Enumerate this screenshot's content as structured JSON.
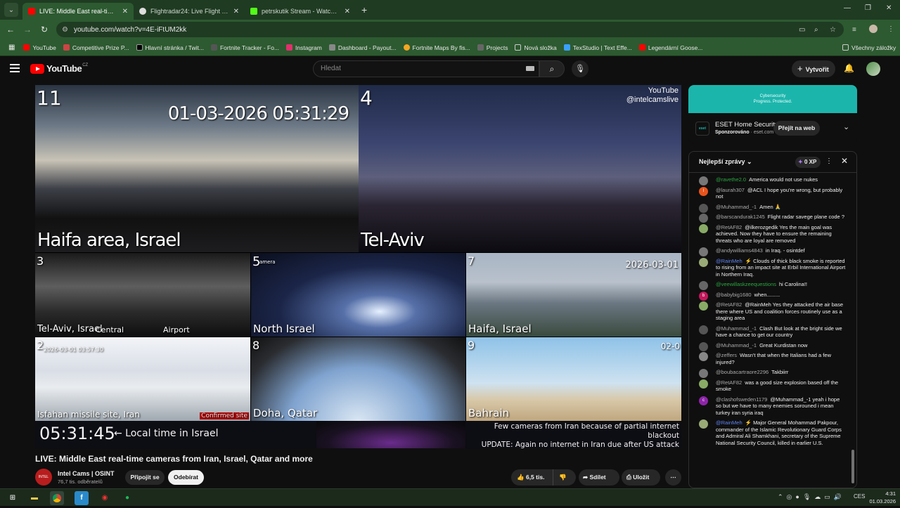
{
  "browser": {
    "tabs": [
      {
        "title": "LIVE: Middle East real-time cam",
        "active": true,
        "favicon_color": "#ff0000"
      },
      {
        "title": "Flightradar24: Live Flight Track",
        "active": false,
        "favicon_color": "#dddddd"
      },
      {
        "title": "petrskutik Stream - Watch Live",
        "active": false,
        "favicon_color": "#53fc18"
      }
    ],
    "new_tab": "+",
    "url": "youtube.com/watch?v=4E-iFtUM2kk",
    "bookmarks": [
      {
        "label": "YouTube",
        "color": "#ff0000"
      },
      {
        "label": "Competitive Prize P...",
        "color": "#c44"
      },
      {
        "label": "Hlavní stránka / Twit...",
        "color": "#000000"
      },
      {
        "label": "Fortnite Tracker - Fo...",
        "color": "#555"
      },
      {
        "label": "Instagram",
        "color": "#e1306c"
      },
      {
        "label": "Dashboard - Payout...",
        "color": "#888"
      },
      {
        "label": "Fortnite Maps By fis...",
        "color": "#f5a623"
      },
      {
        "label": "Projects",
        "color": "#666"
      },
      {
        "label": "Nová složka",
        "color": "#999"
      },
      {
        "label": "TexStudio | Text Effe...",
        "color": "#3aa0ff"
      },
      {
        "label": "Legendární Goose...",
        "color": "#ff0000"
      }
    ],
    "all_bookmarks": "Všechny záložky"
  },
  "yt": {
    "logo": "YouTube",
    "country": "CZ",
    "search_placeholder": "Hledat",
    "create_label": "Vytvořit"
  },
  "video": {
    "watermark_line1": "YouTube",
    "watermark_line2": "@intelcamslive",
    "cams": [
      {
        "num": "11",
        "label": "Haifa area, Israel",
        "timestamp": "01-03-2026 05:31:29"
      },
      {
        "num": "4",
        "label": "Tel-Aviv"
      },
      {
        "num": "3",
        "label": "Tel-Aviv, Israel",
        "extra1": "Central",
        "extra2": "Airport"
      },
      {
        "num": "5",
        "label": "North Israel",
        "extra1": "amera"
      },
      {
        "num": "7",
        "label": "Haifa, Israel",
        "extra1": "2026-03-01"
      },
      {
        "num": "2",
        "label": "Isfahan missile site, Iran",
        "extra1": "Confirmed site",
        "extra2": "2026-03-01 03:57:30"
      },
      {
        "num": "8",
        "label": "Doha, Qatar"
      },
      {
        "num": "9",
        "label": "Bahrain",
        "extra1": "02-0"
      }
    ],
    "clock": "05:31:45",
    "local_note": "← Local time in Israel",
    "notice_line1": "Few cameras from Iran because of partial internet blackout",
    "notice_line2": "UPDATE: Again no internet in Iran due after US attack"
  },
  "meta": {
    "title": "LIVE: Middle East real-time cameras from Iran, Israel, Qatar and more",
    "channel": "Intel Cams | OSINT",
    "channel_avatar_text": "INTEL CAMS",
    "subs": "76,7 tis. odběratelů",
    "join": "Připojit se",
    "subscribe": "Odebírat",
    "likes": "6,5 tis.",
    "share": "Sdílet",
    "save": "Uložit"
  },
  "ad": {
    "banner_line1": "Cybersecurity",
    "banner_line2": "Progress. Protected.",
    "logo": "eset",
    "title": "ESET Home Security",
    "sponsored": "Sponzorováno",
    "domain": "eset.com",
    "cta": "Přejít na web"
  },
  "chat": {
    "mode": "Nejlepší zprávy",
    "xp": "0 XP",
    "messages": [
      {
        "author": "@ravethe2.0",
        "text": "America would not use nukes",
        "type": "member",
        "avatar_color": "#777"
      },
      {
        "author": "@laurah307",
        "text": "@ACL I hope you're wrong, but probably not",
        "type": "normal",
        "avatar_color": "#e8541c",
        "avatar_letter": "l"
      },
      {
        "author": "@Muhammad_-1",
        "text": "Amen 🙏",
        "type": "normal",
        "avatar_color": "#555"
      },
      {
        "author": "@barscandurak1245",
        "text": "Flight radar savege plane code ?",
        "type": "normal",
        "avatar_color": "#666"
      },
      {
        "author": "@RetAF82",
        "text": "@ilkerozgedik Yes the main goal was achieved. Now they have to ensure the remaining threats who are loyal are removed",
        "type": "normal",
        "avatar_color": "#8a6"
      },
      {
        "author": "@andywilliams4843",
        "text": "in Iraq. - osintdef",
        "type": "normal",
        "avatar_color": "#777"
      },
      {
        "author": "@RainMeh",
        "text": "⚡ Clouds of thick black smoke is reported to rising from an impact site at Erbil International Airport in Northern Iraq.",
        "type": "mod",
        "avatar_color": "#9a7"
      },
      {
        "author": "@veewillaskzeequestions",
        "text": "hi Carolina!!",
        "type": "member",
        "avatar_color": "#666"
      },
      {
        "author": "@babybig1680",
        "text": "when.........",
        "type": "normal",
        "avatar_color": "#c2185b",
        "avatar_letter": "b"
      },
      {
        "author": "@RetAF82",
        "text": "@RainMeh Yes they attacked the air base there where US and coalition forces routinely use as a staging area",
        "type": "normal",
        "avatar_color": "#8a6"
      },
      {
        "author": "@Muhammad_-1",
        "text": "Clash But look at the bright side we have a chance to get our country",
        "type": "normal",
        "avatar_color": "#555"
      },
      {
        "author": "@Muhammad_-1",
        "text": "Great Kurdistan now",
        "type": "normal",
        "avatar_color": "#555"
      },
      {
        "author": "@zeffers",
        "text": "Wasn't that when the Italians had a few injured?",
        "type": "normal",
        "avatar_color": "#888"
      },
      {
        "author": "@boubacartraore2296",
        "text": "Takbiirr",
        "type": "normal",
        "avatar_color": "#777"
      },
      {
        "author": "@RetAF82",
        "text": "was a good size explosion based off the smoke",
        "type": "normal",
        "avatar_color": "#8a6"
      },
      {
        "author": "@clashofsweden1179",
        "text": "@Muhammad_-1 yeah i hope so but we have to many enemies sorouned i mean turkey iran syria iraq",
        "type": "normal",
        "avatar_color": "#8e24aa",
        "avatar_letter": "c"
      },
      {
        "author": "@RainMeh",
        "text": "⚡ Major General Mohammad Pakpour, commander of the Islamic Revolutionary Guard Corps and Admiral Ali Shamkhani, secretary of the Supreme National Security Council, killed in earlier U.S.",
        "type": "mod",
        "avatar_color": "#9a7"
      }
    ]
  },
  "taskbar": {
    "lang": "CES",
    "time": "4:31",
    "date": "01.03.2026"
  }
}
